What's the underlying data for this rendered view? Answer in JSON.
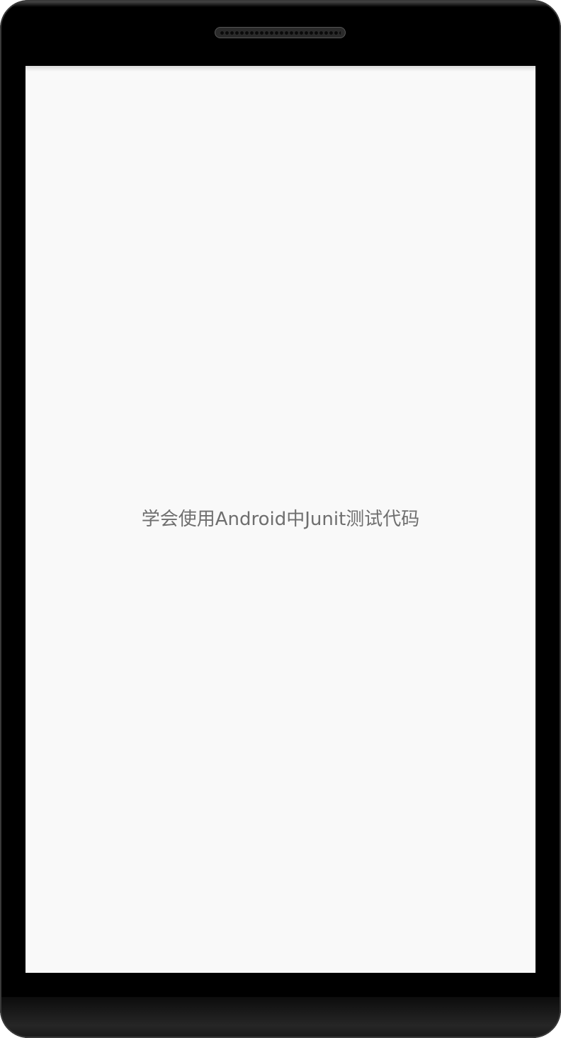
{
  "screen": {
    "center_text": "学会使用Android中Junit测试代码",
    "background_color": "#f9f9f9",
    "text_color": "#6f6f6f"
  },
  "device": {
    "frame_color": "#000000",
    "icons": [
      "speaker-grille"
    ]
  }
}
